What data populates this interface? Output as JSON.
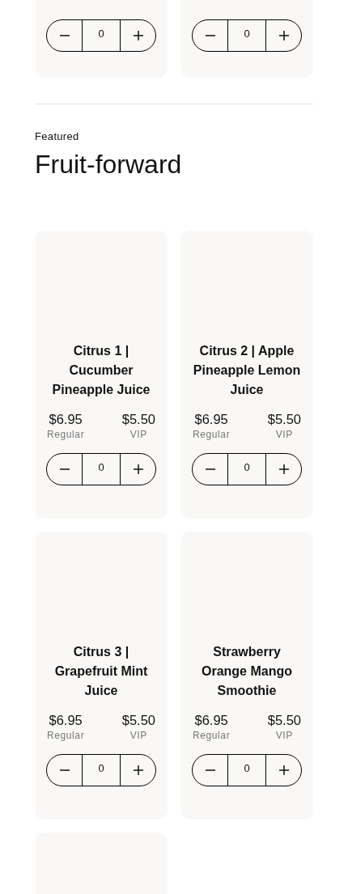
{
  "top_products": [
    {
      "quantity": "0"
    },
    {
      "quantity": "0"
    }
  ],
  "section": {
    "eyebrow": "Featured",
    "title": "Fruit-forward"
  },
  "products": [
    {
      "name": "Citrus 1 | Cucumber Pineapple Juice",
      "regular_price": "$6.95",
      "regular_label": "Regular",
      "vip_price": "$5.50",
      "vip_label": "VIP",
      "quantity": "0"
    },
    {
      "name": "Citrus 2 | Apple Pineapple Lemon Juice",
      "regular_price": "$6.95",
      "regular_label": "Regular",
      "vip_price": "$5.50",
      "vip_label": "VIP",
      "quantity": "0"
    },
    {
      "name": "Citrus 3 | Grapefruit Mint Juice",
      "regular_price": "$6.95",
      "regular_label": "Regular",
      "vip_price": "$5.50",
      "vip_label": "VIP",
      "quantity": "0"
    },
    {
      "name": "Strawberry Orange Mango Smoothie",
      "regular_price": "$6.95",
      "regular_label": "Regular",
      "vip_price": "$5.50",
      "vip_label": "VIP",
      "quantity": "0"
    }
  ]
}
